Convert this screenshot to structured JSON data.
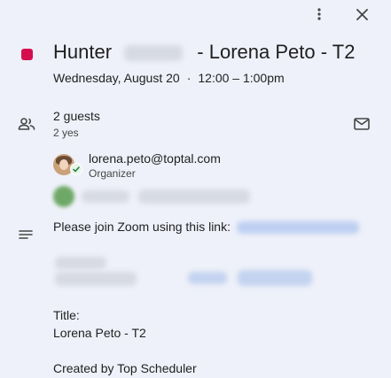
{
  "event": {
    "color": "#d50f4f",
    "title_first": "Hunter",
    "title_rest": "- Lorena Peto - T2",
    "date": "Wednesday, August 20",
    "separator": "·",
    "time": "12:00 – 1:00pm"
  },
  "toolbar": {
    "more_icon": "more-vert-icon",
    "close_icon": "close-icon"
  },
  "guests": {
    "count_label": "2 guests",
    "summary": "2 yes",
    "email_icon": "mail-icon",
    "organizer": {
      "email": "lorena.peto@toptal.com",
      "role": "Organizer"
    }
  },
  "description": {
    "join_text": "Please join Zoom using this link:",
    "title_label": "Title:",
    "title_value": "Lorena Peto - T2",
    "created_by": "Created by Top Scheduler"
  },
  "colors": {
    "background": "#eef1f9",
    "accent": "#d50f4f",
    "link_blurred": "#aac4f2",
    "verified": "#188038"
  }
}
